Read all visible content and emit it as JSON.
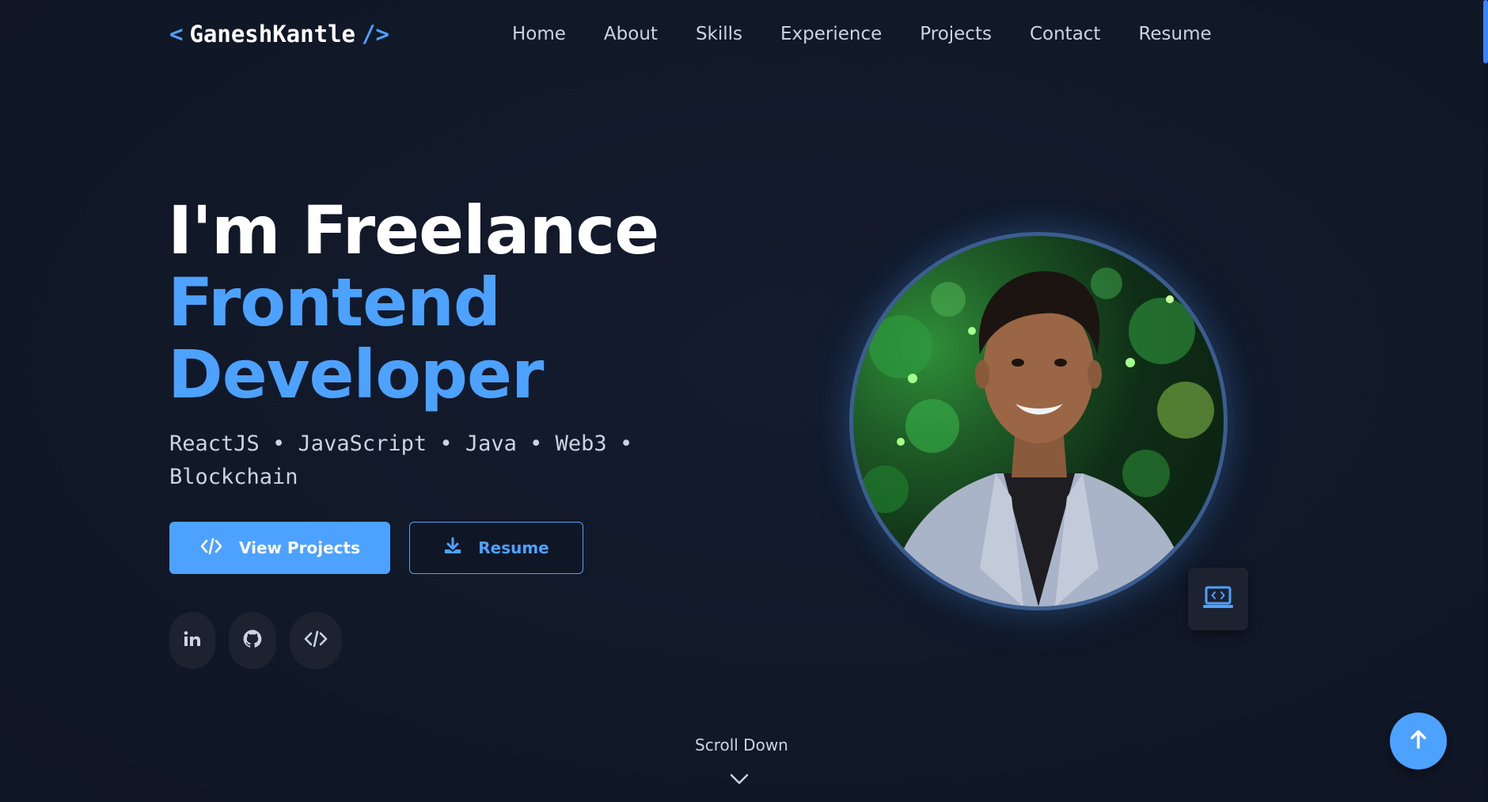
{
  "brand": {
    "open_bracket": "<",
    "name": "GaneshKantle",
    "close_bracket": "/>"
  },
  "nav": {
    "items": [
      "Home",
      "About",
      "Skills",
      "Experience",
      "Projects",
      "Contact",
      "Resume"
    ]
  },
  "hero": {
    "line1": "I'm Freelance",
    "line2": "Frontend",
    "line3": "Developer",
    "skills": "ReactJS • JavaScript • Java • Web3 • Blockchain"
  },
  "buttons": {
    "view_projects": "View Projects",
    "resume": "Resume"
  },
  "social": {
    "linkedin_icon": "linkedin-icon",
    "github_icon": "github-icon",
    "code_icon": "code-icon"
  },
  "scroll": {
    "label": "Scroll Down"
  },
  "colors": {
    "background": "#111827",
    "accent": "#4da1ff",
    "text": "#cbd5e1"
  }
}
